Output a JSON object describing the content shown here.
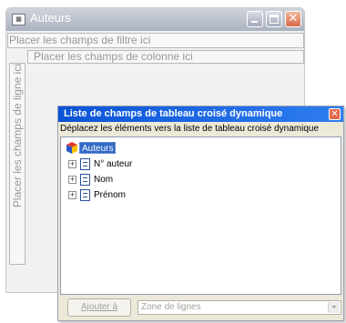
{
  "window": {
    "title": "Auteurs"
  },
  "pivot": {
    "filter_drop": "Placer les champs de filtre ici",
    "column_drop": "Placer les champs de colonne ici",
    "row_drop": "Placer les champs de ligne ici",
    "data_drop_partial": "Pl"
  },
  "field_list": {
    "title": "Liste de champs de tableau croisé dynamique",
    "instruction": "Déplacez les éléments vers la liste de tableau croisé dynamique",
    "root_label": "Auteurs",
    "fields": [
      {
        "label": "N° auteur"
      },
      {
        "label": "Nom"
      },
      {
        "label": "Prénom"
      }
    ],
    "add_button_label": "Ajouter à",
    "zone_select_value": "Zone de lignes"
  },
  "colors": {
    "titlebar_inactive": "#bcc2cd",
    "panel_titlebar": "#0a53d6",
    "selection": "#316ac5",
    "drop_zone_text": "#999999"
  }
}
